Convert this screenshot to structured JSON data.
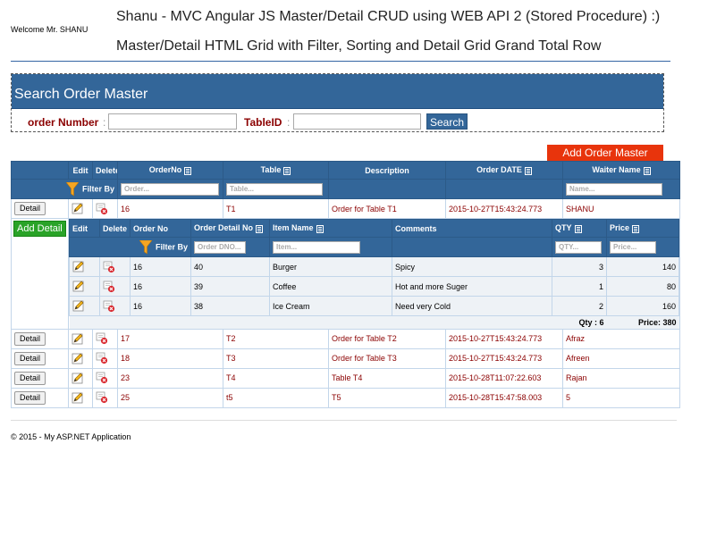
{
  "header": {
    "welcome": "Welcome Mr. SHANU",
    "title": "Shanu - MVC Angular JS Master/Detail CRUD using WEB API 2 (Stored Procedure) :)",
    "subtitle": "Master/Detail HTML Grid with Filter, Sorting and Detail Grid Grand Total Row"
  },
  "search": {
    "title": "Search Order Master",
    "order_label": "order Number",
    "table_label": "TableID",
    "colon": ":",
    "button": "Search"
  },
  "add_master_label": "Add Order Master",
  "master": {
    "headers": {
      "edit": "Edit",
      "delete": "Delete",
      "orderno": "OrderNo",
      "table": "Table",
      "description": "Description",
      "orderdate": "Order DATE",
      "waiter": "Waiter Name"
    },
    "filter_label": "Filter By",
    "placeholders": {
      "order": "Order...",
      "table": "Table...",
      "name": "Name..."
    },
    "detail_button": "Detail",
    "rows": [
      {
        "orderno": "16",
        "table": "T1",
        "description": "Order for Table T1",
        "date": "2015-10-27T15:43:24.773",
        "waiter": "SHANU"
      },
      {
        "orderno": "17",
        "table": "T2",
        "description": "Order for Table T2",
        "date": "2015-10-27T15:43:24.773",
        "waiter": "Afraz"
      },
      {
        "orderno": "18",
        "table": "T3",
        "description": "Order for Table T3",
        "date": "2015-10-27T15:43:24.773",
        "waiter": "Afreen"
      },
      {
        "orderno": "23",
        "table": "T4",
        "description": "Table T4",
        "date": "2015-10-28T11:07:22.603",
        "waiter": "Rajan"
      },
      {
        "orderno": "25",
        "table": "t5",
        "description": "T5",
        "date": "2015-10-28T15:47:58.003",
        "waiter": "5"
      }
    ]
  },
  "detail": {
    "add_label": "Add Detail",
    "headers": {
      "edit": "Edit",
      "delete": "Delete",
      "orderno": "Order No",
      "detailno": "Order Detail No",
      "item": "Item Name",
      "comments": "Comments",
      "qty": "QTY",
      "price": "Price"
    },
    "filter_label": "Filter By",
    "placeholders": {
      "dno": "Order DNO...",
      "item": "Item...",
      "qty": "QTY...",
      "price": "Price..."
    },
    "rows": [
      {
        "orderno": "16",
        "detailno": "40",
        "item": "Burger",
        "comments": "Spicy",
        "qty": "3",
        "price": "140"
      },
      {
        "orderno": "16",
        "detailno": "39",
        "item": "Coffee",
        "comments": "Hot and more Suger",
        "qty": "1",
        "price": "80"
      },
      {
        "orderno": "16",
        "detailno": "38",
        "item": "Ice Cream",
        "comments": "Need very Cold",
        "qty": "2",
        "price": "160"
      }
    ],
    "total_qty": "Qty : 6",
    "total_price": "Price: 380"
  },
  "footer": "© 2015 - My ASP.NET Application",
  "colors": {
    "header_blue": "#336699",
    "add_master_red": "#e8340c",
    "add_detail_green": "#2aa328",
    "text_darkred": "#8b0000"
  }
}
